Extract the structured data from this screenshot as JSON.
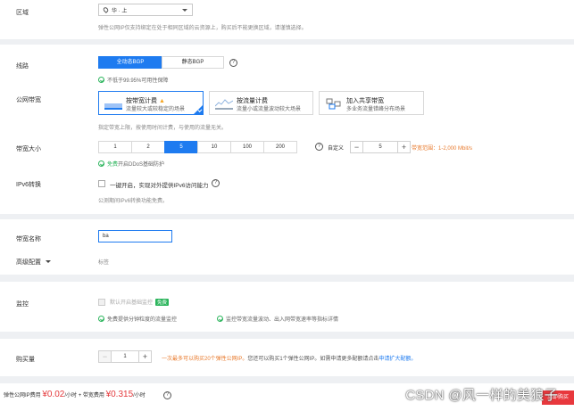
{
  "region": {
    "label": "区域",
    "select_value": "华 · 上",
    "hint": "弹性公网IP仅支持绑定在处于相同区域的云资源上，购买后不能更换区域，请谨慎选择。"
  },
  "line": {
    "label": "线路",
    "options": [
      "全动态BGP",
      "静态BGP"
    ],
    "selected": "全动态BGP",
    "availability": "不低于99.95%可用性保障"
  },
  "bandwidth_type": {
    "label": "公网带宽",
    "options": [
      {
        "title": "按带宽计费",
        "desc": "流量较大或较稳定的场景",
        "selected": true
      },
      {
        "title": "按流量计费",
        "desc": "流量小或流量波动较大场景",
        "selected": false
      },
      {
        "title": "加入共享带宽",
        "desc": "多业务流量错峰分布场景",
        "selected": false
      }
    ],
    "hint": "指定带宽上限，按使用时间计费，与使用的流量无关。"
  },
  "bandwidth_size": {
    "label": "带宽大小",
    "options": [
      "1",
      "2",
      "5",
      "10",
      "100",
      "200"
    ],
    "selected": "5",
    "custom_label": "自定义",
    "value": "5",
    "range": "带宽范围：1-2,000 Mbit/s",
    "ddos": "免费开启DDoS基础防护",
    "ddos_prefix": "免费",
    "ddos_rest": "开启DDoS基础防护"
  },
  "ipv6": {
    "label": "IPv6转换",
    "checkbox_label": "一键开启，实现对外提供IPv6访问能力",
    "hint": "公测期间IPv6转换功能免费。"
  },
  "bandwidth_name": {
    "label": "带宽名称",
    "value": "ba"
  },
  "advanced": {
    "label": "高级配置",
    "value": "标签"
  },
  "monitor": {
    "label": "监控",
    "checkbox_label": "默认开启基础监控",
    "badge": "免费",
    "feature1": "免费提供分钟粒度的流量监控",
    "feature2": "监控带宽流量波动、出入网带宽速率等指标详情"
  },
  "quantity": {
    "label": "购买量",
    "value": "1",
    "note_prefix": "一次最多可以购买20个弹性公网IP。",
    "note_mid": "您还可以购买1个弹性公网IP。如需申请更多配额请点击",
    "note_link": "申请扩大配额。"
  },
  "footer": {
    "eip_label": "弹性公网IP费用",
    "eip_price": "¥0.02",
    "eip_unit": "/小时 + 带宽费用",
    "bw_price": "¥0.315",
    "bw_unit": "/小时",
    "buy_label": "立即购买"
  },
  "watermark": "CSDN @风一样的美狼子",
  "colors": {
    "accent": "#1e7bf0",
    "price": "#e4393c",
    "success": "#2db55d"
  }
}
